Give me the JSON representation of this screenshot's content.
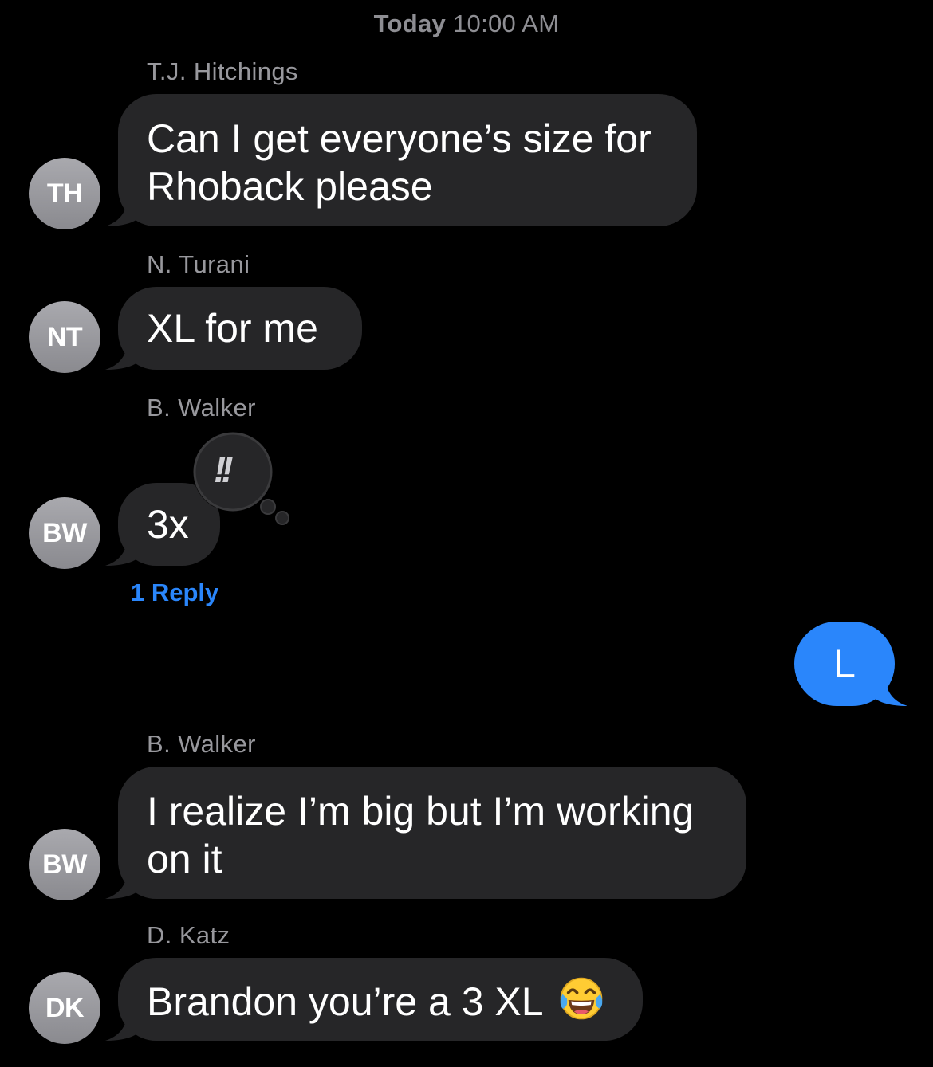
{
  "header": {
    "timestamp_day": "Today",
    "timestamp_time": "10:00 AM"
  },
  "messages": [
    {
      "sender": "T.J. Hitchings",
      "initials": "TH",
      "line1": "Can I get everyone’s size for",
      "line2": "Rhoback please"
    },
    {
      "sender": "N. Turani",
      "initials": "NT",
      "text": "XL for me"
    },
    {
      "sender": "B. Walker",
      "initials": "BW",
      "text": "3x",
      "reaction": "!!",
      "reply_count": "1 Reply"
    },
    {
      "outgoing_text": "L"
    },
    {
      "sender": "B. Walker",
      "initials": "BW",
      "line1": "I realize I’m big but I’m working",
      "line2": "on it"
    },
    {
      "sender": "D. Katz",
      "initials": "DK",
      "text": "Brandon you’re a 3 XL",
      "emoji": "face-with-tears-of-joy-icon"
    }
  ],
  "colors": {
    "background": "#000000",
    "incoming_bubble": "#262628",
    "outgoing_bubble": "#2a86fb",
    "link": "#2a86fb",
    "secondary_text": "#98989d"
  }
}
